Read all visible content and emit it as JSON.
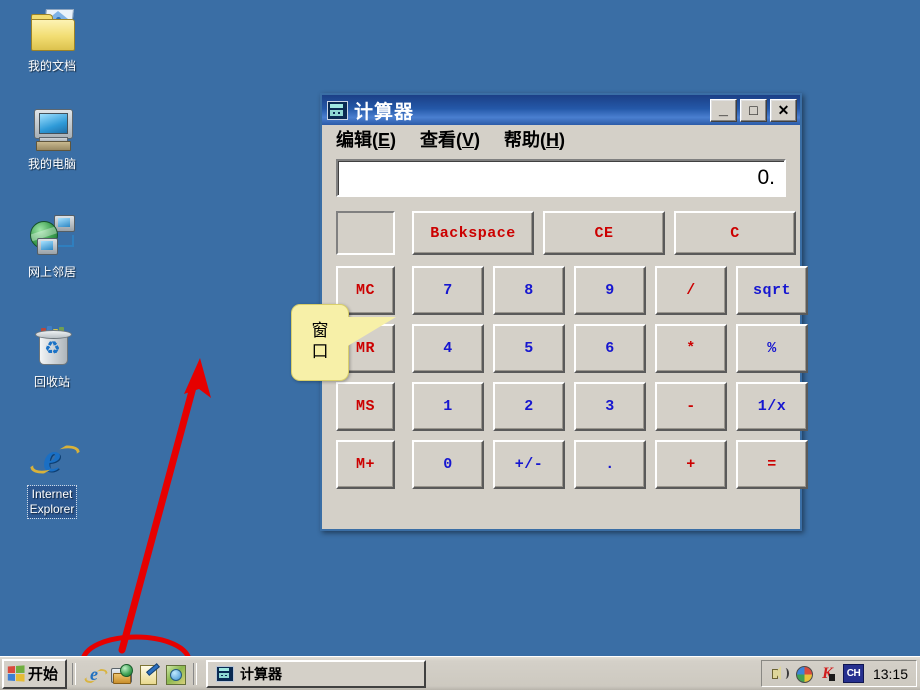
{
  "desktop": {
    "icons": [
      {
        "label": "我的文档",
        "icon": "folder-documents-icon",
        "selected": false
      },
      {
        "label": "我的电脑",
        "icon": "my-computer-icon",
        "selected": false
      },
      {
        "label": "网上邻居",
        "icon": "network-places-icon",
        "selected": false
      },
      {
        "label": "回收站",
        "icon": "recycle-bin-icon",
        "selected": false
      },
      {
        "label": "Internet\nExplorer",
        "label_line1": "Internet",
        "label_line2": "Explorer",
        "icon": "internet-explorer-icon",
        "selected": true
      }
    ],
    "background_color": "#3a6ea5"
  },
  "calculator": {
    "title": "计算器",
    "title_icon": "calculator-icon",
    "window_buttons": {
      "minimize": "_",
      "maximize": "□",
      "close": "✕"
    },
    "menu": [
      {
        "label": "编辑",
        "accel": "E"
      },
      {
        "label": "查看",
        "accel": "V"
      },
      {
        "label": "帮助",
        "accel": "H"
      }
    ],
    "display_value": "0.",
    "memory_indicator": "",
    "function_row": [
      {
        "label": "Backspace",
        "color": "#cc0000"
      },
      {
        "label": "CE",
        "color": "#cc0000"
      },
      {
        "label": "C",
        "color": "#cc0000"
      }
    ],
    "rows": [
      {
        "memory": {
          "label": "MC",
          "color": "#cc0000"
        },
        "keys": [
          {
            "label": "7",
            "color": "#1616d0"
          },
          {
            "label": "8",
            "color": "#1616d0"
          },
          {
            "label": "9",
            "color": "#1616d0"
          },
          {
            "label": "/",
            "color": "#cc0000"
          },
          {
            "label": "sqrt",
            "color": "#1616d0"
          }
        ]
      },
      {
        "memory": {
          "label": "MR",
          "color": "#cc0000"
        },
        "keys": [
          {
            "label": "4",
            "color": "#1616d0"
          },
          {
            "label": "5",
            "color": "#1616d0"
          },
          {
            "label": "6",
            "color": "#1616d0"
          },
          {
            "label": "*",
            "color": "#cc0000"
          },
          {
            "label": "%",
            "color": "#1616d0"
          }
        ]
      },
      {
        "memory": {
          "label": "MS",
          "color": "#cc0000"
        },
        "keys": [
          {
            "label": "1",
            "color": "#1616d0"
          },
          {
            "label": "2",
            "color": "#1616d0"
          },
          {
            "label": "3",
            "color": "#1616d0"
          },
          {
            "label": "-",
            "color": "#cc0000"
          },
          {
            "label": "1/x",
            "color": "#1616d0"
          }
        ]
      },
      {
        "memory": {
          "label": "M+",
          "color": "#cc0000"
        },
        "keys": [
          {
            "label": "0",
            "color": "#1616d0"
          },
          {
            "label": "+/-",
            "color": "#1616d0"
          },
          {
            "label": ".",
            "color": "#1616d0"
          },
          {
            "label": "+",
            "color": "#cc0000"
          },
          {
            "label": "=",
            "color": "#cc0000"
          }
        ]
      }
    ]
  },
  "annotations": {
    "callout_text_line1": "窗",
    "callout_text_line2": "口",
    "callout_color": "#f7f0a8",
    "arrow_color": "#e60000",
    "ellipse_color": "#e60000"
  },
  "taskbar": {
    "start_label": "开始",
    "quick_launch": [
      {
        "name": "internet-explorer-icon"
      },
      {
        "name": "show-desktop-icon"
      },
      {
        "name": "notepad-icon"
      },
      {
        "name": "media-player-icon"
      }
    ],
    "task_buttons": [
      {
        "label": "计算器",
        "icon": "calculator-icon",
        "active": true
      }
    ],
    "tray": [
      {
        "name": "volume-icon"
      },
      {
        "name": "network-globe-icon"
      },
      {
        "name": "kaspersky-icon"
      },
      {
        "name": "ime-indicator",
        "label": "CH"
      }
    ],
    "clock": "13:15"
  }
}
